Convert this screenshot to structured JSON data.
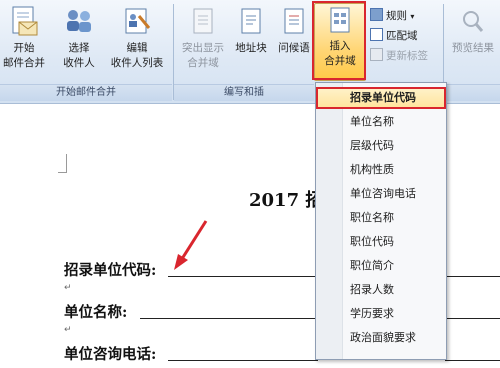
{
  "ribbon": {
    "start_merge": {
      "line1": "开始",
      "line2": "邮件合并"
    },
    "select_recipients": {
      "line1": "选择",
      "line2": "收件人"
    },
    "edit_recipients": {
      "line1": "编辑",
      "line2": "收件人列表"
    },
    "group_start": "开始邮件合并",
    "highlight_fields": {
      "line1": "突出显示",
      "line2": "合并域"
    },
    "address_block": "地址块",
    "greeting_line": "问候语",
    "insert_field": {
      "line1": "插入",
      "line2": "合并域"
    },
    "rules": "规则",
    "match_fields": "匹配域",
    "update_labels": "更新标签",
    "group_write": "编写和插",
    "preview_results": "预览结果"
  },
  "dropdown": {
    "items": [
      "招录单位代码",
      "单位名称",
      "层级代码",
      "机构性质",
      "单位咨询电话",
      "职位名称",
      "职位代码",
      "职位简介",
      "招录人数",
      "学历要求",
      "政治面貌要求"
    ],
    "selected_index": 0
  },
  "document": {
    "title": "2017 招",
    "fields": [
      "招录单位代码:",
      "单位名称:",
      "单位咨询电话:"
    ],
    "para_mark": "↵"
  },
  "colors": {
    "highlight_border": "#d9262e",
    "arrow": "#d9262e",
    "ribbon_bg": "#dfe9f5"
  }
}
